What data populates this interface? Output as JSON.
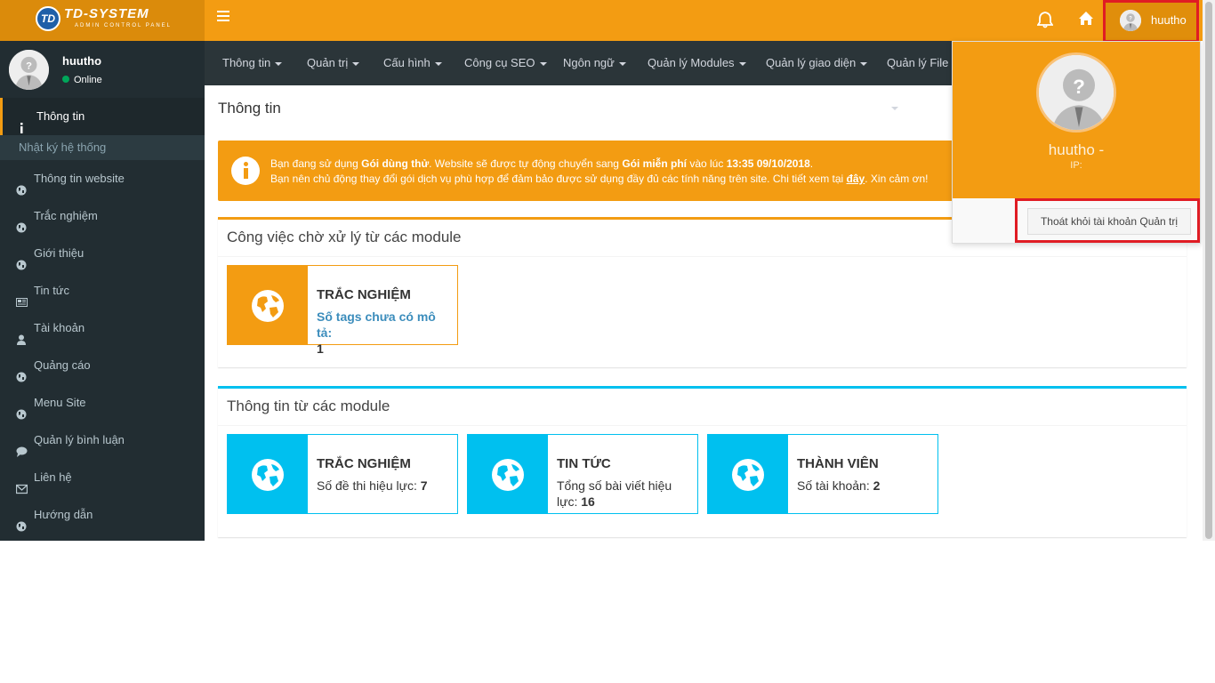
{
  "brand": {
    "logo_mark": "TD",
    "logo_text": "TD-SYSTEM",
    "logo_sub": "ADMIN CONTROL PANEL"
  },
  "colors": {
    "accent": "#f39c12",
    "sidebar": "#222d32",
    "info": "#00c0ef",
    "highlight": "#e01c24"
  },
  "topbar": {
    "icons": [
      "menu-icon",
      "bell-icon",
      "home-icon"
    ],
    "username": "huutho"
  },
  "sidebar": {
    "user": {
      "name": "huutho",
      "status": "Online"
    },
    "items": [
      {
        "label": "Thông tin",
        "icon": "info-icon"
      },
      {
        "label": "Thông tin website",
        "icon": "globe-icon"
      },
      {
        "label": "Trắc nghiệm",
        "icon": "globe-icon"
      },
      {
        "label": "Giới thiệu",
        "icon": "globe-icon"
      },
      {
        "label": "Tin tức",
        "icon": "newspaper-icon"
      },
      {
        "label": "Tài khoản",
        "icon": "user-icon"
      },
      {
        "label": "Quảng cáo",
        "icon": "globe-icon"
      },
      {
        "label": "Menu Site",
        "icon": "globe-icon"
      },
      {
        "label": "Quản lý bình luận",
        "icon": "comment-icon"
      },
      {
        "label": "Liên hệ",
        "icon": "envelope-icon"
      },
      {
        "label": "Hướng dẫn",
        "icon": "globe-icon"
      }
    ],
    "subitem": "Nhật ký hệ thống"
  },
  "navbar": {
    "items": [
      "Thông tin",
      "Quản trị",
      "Cấu hình",
      "Công cụ SEO",
      "Ngôn ngữ",
      "Quản lý Modules",
      "Quản lý giao diện",
      "Quản lý File"
    ]
  },
  "page": {
    "title": "Thông tin"
  },
  "alert": {
    "l1a": "Bạn đang sử dụng ",
    "l1b": "Gói dùng thử",
    "l1c": ". Website sẽ được tự động chuyển sang ",
    "l1d": "Gói miễn phí",
    "l1e": " vào lúc ",
    "l1f": "13:35 09/10/2018",
    "l2a": "Bạn nên chủ động thay đổi gói dịch vụ phù hợp để đảm bảo được sử dụng đầy đủ các tính năng trên site. Chi tiết xem tại ",
    "l2b": "đây",
    "l2c": ". Xin cảm ơn!"
  },
  "pending": {
    "title": "Công việc chờ xử lý từ các module",
    "cards": [
      {
        "title": "TRẮC NGHIỆM",
        "label": "Số tags chưa có mô tả:",
        "value": "1"
      }
    ]
  },
  "modules": {
    "title": "Thông tin từ các module",
    "cards": [
      {
        "title": "TRẮC NGHIỆM",
        "label": "Số đề thi hiệu lực: ",
        "value": "7"
      },
      {
        "title": "TIN TỨC",
        "label": "Tổng số bài viết hiệu lực: ",
        "value": "16"
      },
      {
        "title": "THÀNH VIÊN",
        "label": "Số tài khoản: ",
        "value": "2"
      }
    ]
  },
  "dropdown": {
    "name": "huutho -",
    "ip": "IP:",
    "logout": "Thoát khỏi tài khoản Quản trị"
  }
}
